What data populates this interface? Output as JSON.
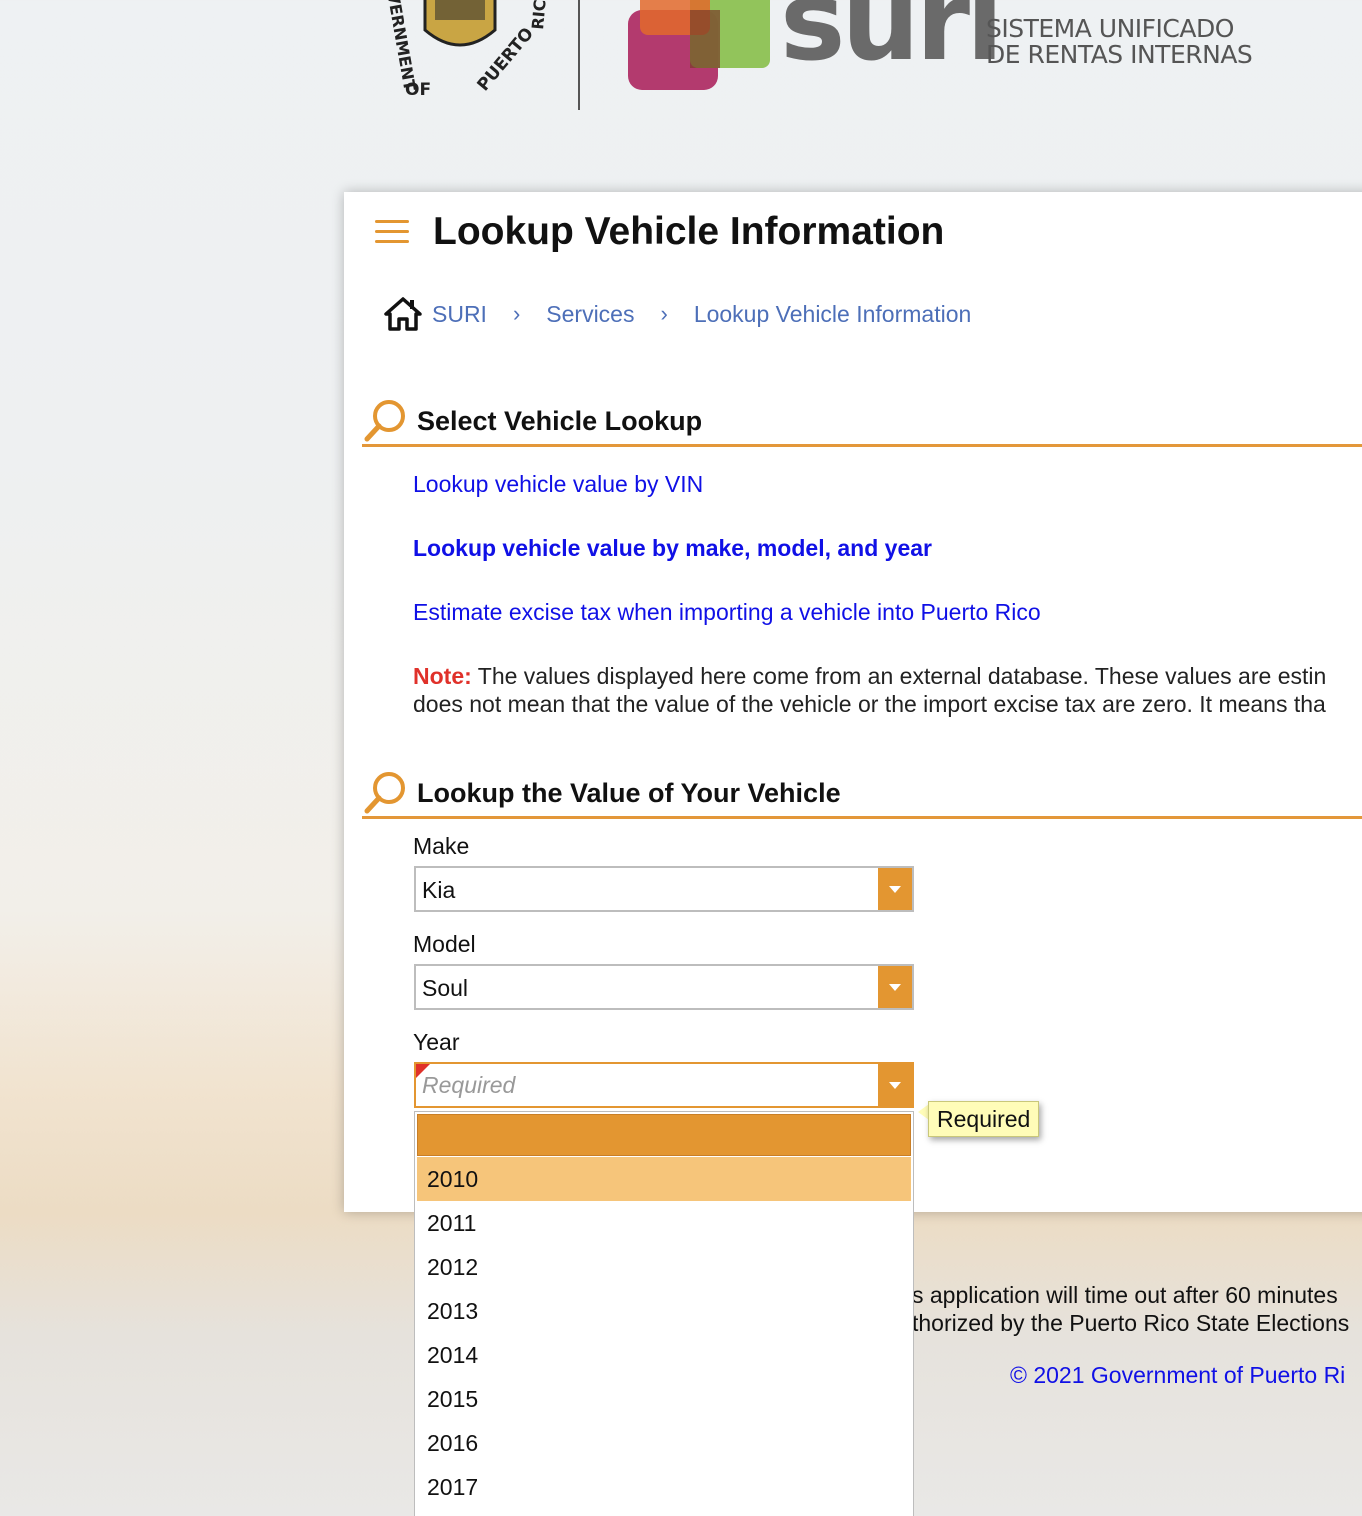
{
  "header": {
    "seal_text_left": "OVERNMENT OF PUERTO RIC",
    "logo_word": "suri",
    "logo_subtitle_line1": "SISTEMA UNIFICADO",
    "logo_subtitle_line2": "DE RENTAS INTERNAS"
  },
  "page": {
    "title": "Lookup Vehicle Information"
  },
  "breadcrumb": {
    "items": [
      "SURI",
      "Services",
      "Lookup Vehicle Information"
    ]
  },
  "section_select": {
    "heading": "Select Vehicle Lookup",
    "links": [
      "Lookup vehicle value by VIN",
      "Lookup vehicle value by make, model, and year",
      "Estimate excise tax when importing a vehicle into Puerto Rico"
    ],
    "note_label": "Note:",
    "note_line1": "The values displayed here come from an external database. These values are estin",
    "note_line2": "does not mean that the value of the vehicle or the import excise tax are zero. It means tha"
  },
  "section_lookup": {
    "heading": "Lookup the Value of Your Vehicle",
    "make_label": "Make",
    "make_value": "Kia",
    "model_label": "Model",
    "model_value": "Soul",
    "year_label": "Year",
    "year_placeholder": "Required",
    "tooltip": "Required"
  },
  "year_dropdown": {
    "options": [
      "2010",
      "2011",
      "2012",
      "2013",
      "2014",
      "2015",
      "2016",
      "2017"
    ]
  },
  "footer": {
    "line1": "s application will time out after 60 minutes",
    "line2": "thorized by the Puerto Rico State Elections",
    "copyright": "© 2021 Government of Puerto Ri"
  },
  "colors": {
    "accent": "#e39631",
    "link": "#1010e6",
    "breadcrumb": "#4d6fb8",
    "note": "#e0312a"
  }
}
